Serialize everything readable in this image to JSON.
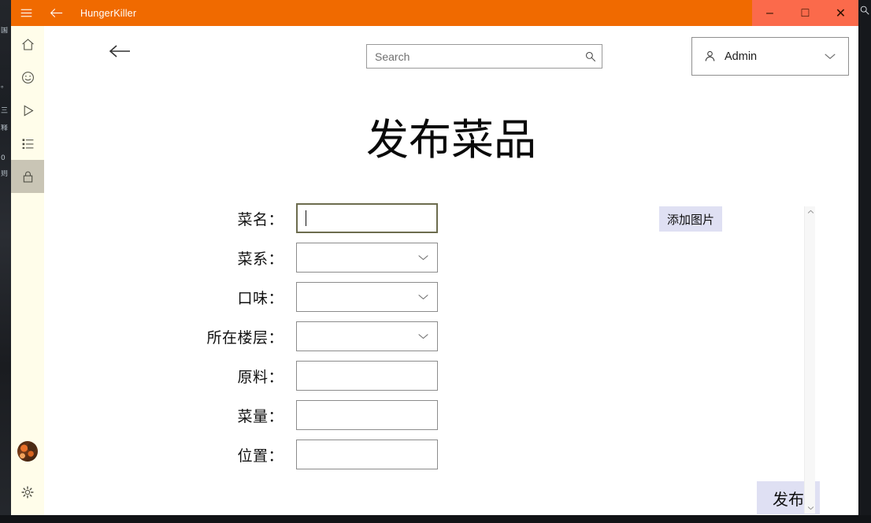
{
  "window": {
    "title": "HungerKiller",
    "titlebar_buttons": [
      {
        "name": "hamburger-menu",
        "icon": "hamburger-icon"
      },
      {
        "name": "back",
        "icon": "back-arrow-icon"
      }
    ],
    "controls": [
      {
        "name": "minimize",
        "glyph": "–"
      },
      {
        "name": "maximize",
        "glyph": "□"
      },
      {
        "name": "close",
        "glyph": "✕"
      }
    ],
    "accent_color": "#f06a00",
    "control_bar_color": "#fb6a4b"
  },
  "sidebar": {
    "background": "#fffdea",
    "selected_background": "#c9c5b5",
    "items": [
      {
        "id": "home",
        "icon": "home-icon",
        "selected": false
      },
      {
        "id": "mood",
        "icon": "smiley-face-icon",
        "selected": false
      },
      {
        "id": "play",
        "icon": "play-triangle-icon",
        "selected": false
      },
      {
        "id": "list",
        "icon": "list-icon",
        "selected": false
      },
      {
        "id": "lock",
        "icon": "lock-icon",
        "selected": true
      }
    ],
    "bottom": [
      {
        "id": "avatar",
        "icon": "avatar-icon"
      },
      {
        "id": "settings",
        "icon": "gear-icon"
      }
    ]
  },
  "topbar": {
    "back_icon": "back-arrow-icon",
    "search": {
      "placeholder": "Search",
      "value": "",
      "icon": "search-icon"
    },
    "account": {
      "icon": "person-icon",
      "name": "Admin",
      "chevron": "chevron-down-icon"
    }
  },
  "page": {
    "title": "发布菜品"
  },
  "form": {
    "fields": [
      {
        "label": "菜名：",
        "type": "text",
        "value": "",
        "focused": true
      },
      {
        "label": "菜系：",
        "type": "select",
        "value": "",
        "focused": false
      },
      {
        "label": "口味：",
        "type": "select",
        "value": "",
        "focused": false
      },
      {
        "label": "所在楼层：",
        "type": "select",
        "value": "",
        "focused": false
      },
      {
        "label": "原料：",
        "type": "text",
        "value": "",
        "focused": false
      },
      {
        "label": "菜量：",
        "type": "text",
        "value": "",
        "focused": false
      },
      {
        "label": "位置：",
        "type": "text",
        "value": "",
        "focused": false
      }
    ]
  },
  "right_panel": {
    "add_image_label": "添加图片",
    "publish_label": "发布",
    "button_color": "#dfe0f3",
    "scrollbar": {
      "up_icon": "chevron-up-icon",
      "down_icon": "chevron-down-icon"
    }
  },
  "desktop": {
    "flecks": [
      "国",
      "",
      "。",
      "三",
      "释",
      "0",
      "则"
    ],
    "search_icon": "search-icon"
  }
}
